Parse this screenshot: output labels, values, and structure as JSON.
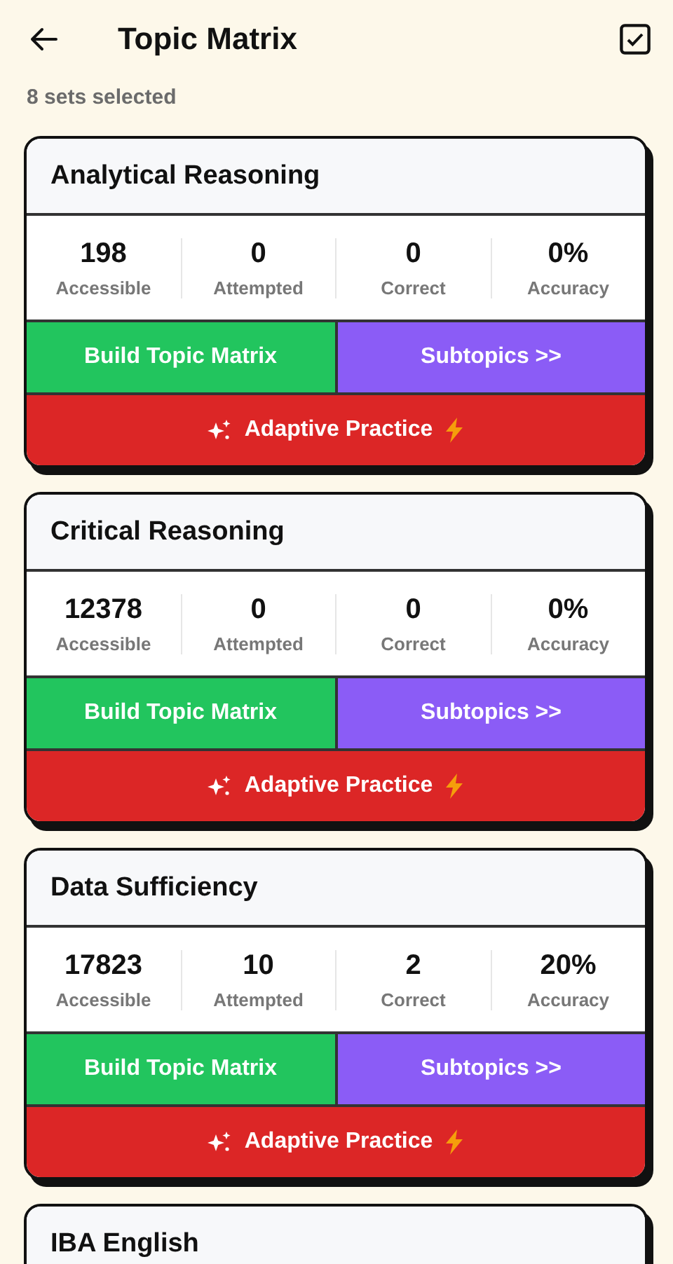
{
  "header": {
    "title": "Topic Matrix",
    "subtitle": "8 sets selected"
  },
  "cards": [
    {
      "title": "Analytical Reasoning",
      "stats": [
        {
          "value": "198",
          "label": "Accessible"
        },
        {
          "value": "0",
          "label": "Attempted"
        },
        {
          "value": "0",
          "label": "Correct"
        },
        {
          "value": "0%",
          "label": "Accuracy"
        }
      ],
      "build_button": "Build Topic Matrix",
      "subtopics_button": "Subtopics >>",
      "practice_button": "Adaptive Practice"
    },
    {
      "title": "Critical Reasoning",
      "stats": [
        {
          "value": "12378",
          "label": "Accessible"
        },
        {
          "value": "0",
          "label": "Attempted"
        },
        {
          "value": "0",
          "label": "Correct"
        },
        {
          "value": "0%",
          "label": "Accuracy"
        }
      ],
      "build_button": "Build Topic Matrix",
      "subtopics_button": "Subtopics >>",
      "practice_button": "Adaptive Practice"
    },
    {
      "title": "Data Sufficiency",
      "stats": [
        {
          "value": "17823",
          "label": "Accessible"
        },
        {
          "value": "10",
          "label": "Attempted"
        },
        {
          "value": "2",
          "label": "Correct"
        },
        {
          "value": "20%",
          "label": "Accuracy"
        }
      ],
      "build_button": "Build Topic Matrix",
      "subtopics_button": "Subtopics >>",
      "practice_button": "Adaptive Practice"
    },
    {
      "title": "IBA English"
    }
  ]
}
